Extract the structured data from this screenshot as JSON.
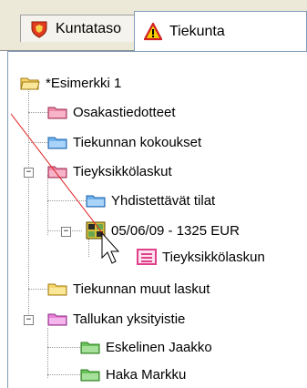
{
  "tabs": [
    {
      "label": "Kuntataso",
      "icon": "shield-icon"
    },
    {
      "label": "Tiekunta",
      "icon": "warning-triangle-icon"
    }
  ],
  "tree": {
    "root": {
      "label": "*Esimerkki 1",
      "icon": "folder-open-icon"
    },
    "items": [
      {
        "label": "Osakastiedotteet",
        "icon": "folder-pink-icon"
      },
      {
        "label": "Tiekunnan kokoukset",
        "icon": "folder-blue-icon"
      },
      {
        "label": "Tieyksikkölaskut",
        "icon": "folder-pink-icon",
        "expander": "−"
      },
      {
        "label": "Yhdistettävät tilat",
        "icon": "folder-blue-icon"
      },
      {
        "label": "05/06/09 - 1325 EUR",
        "icon": "table-grid-icon",
        "expander": "−"
      },
      {
        "label": "Tieyksikkölaskun",
        "icon": "document-pink-icon"
      },
      {
        "label": "Tiekunnan muut laskut",
        "icon": "folder-yellow-icon"
      },
      {
        "label": "Tallukan yksityistie",
        "icon": "folder-pink-icon",
        "expander": "−"
      },
      {
        "label": "Eskelinen Jaakko",
        "icon": "folder-green-icon"
      },
      {
        "label": "Haka Markku",
        "icon": "folder-green-icon"
      }
    ]
  },
  "colors": {
    "folder_yellow": "#f6d56b",
    "folder_pink": "#f08aa8",
    "folder_blue": "#6fb3ef",
    "folder_green": "#69c35a",
    "doc_pink": "#e0408a",
    "pointer_line": "#e02020"
  }
}
